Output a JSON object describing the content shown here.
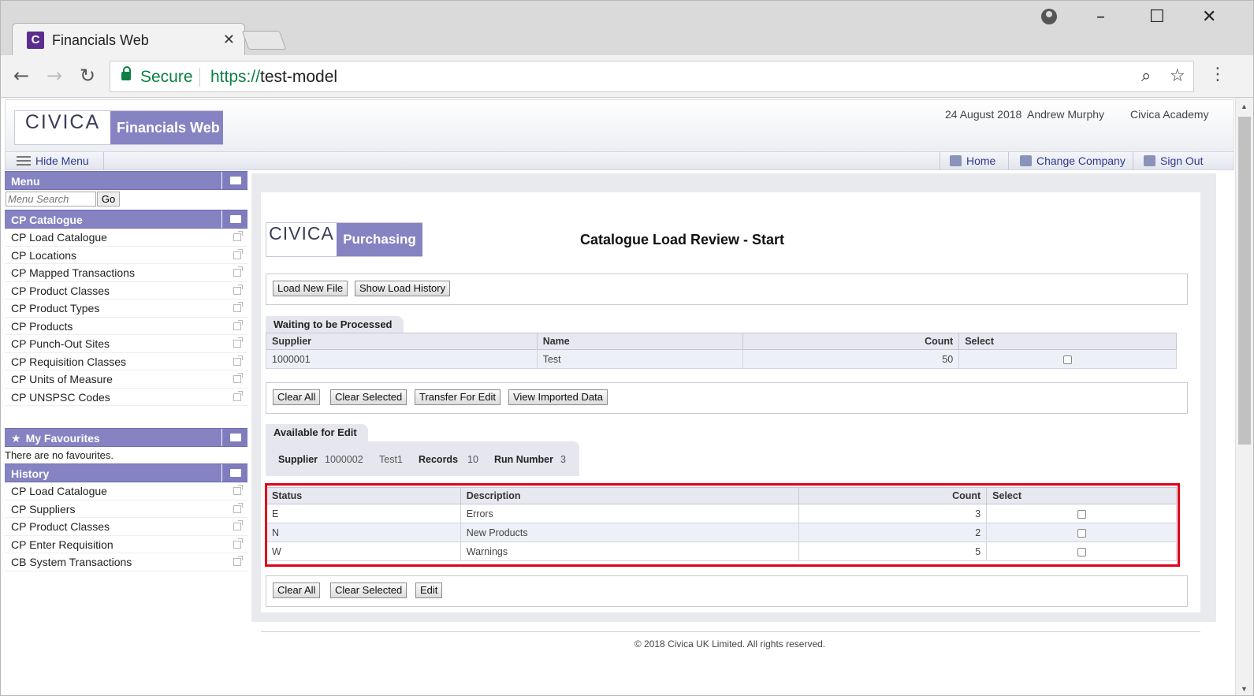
{
  "browser": {
    "tab_title": "Financials Web",
    "tab_favicon": "C",
    "tab_close": "✕",
    "secure_label": "Secure",
    "url_protocol": "https://",
    "url_host": "test-model"
  },
  "app": {
    "logo_text": "CIVICA",
    "app_name": "Financials Web",
    "date": "24 August 2018",
    "user": "Andrew Murphy",
    "company": "Civica Academy",
    "hide_menu": "Hide Menu",
    "nav": {
      "home": "Home",
      "change_company": "Change Company",
      "sign_out": "Sign Out"
    }
  },
  "sidebar": {
    "menu_title": "Menu",
    "search_placeholder": "Menu Search",
    "go_label": "Go",
    "catalogue_title": "CP Catalogue",
    "catalogue_items": [
      "CP Load Catalogue",
      "CP Locations",
      "CP Mapped Transactions",
      "CP Product Classes",
      "CP Product Types",
      "CP Products",
      "CP Punch-Out Sites",
      "CP Requisition Classes",
      "CP Units of Measure",
      "CP UNSPSC Codes"
    ],
    "favourites_title": "My Favourites",
    "no_favourites": "There are no favourites.",
    "history_title": "History",
    "history_items": [
      "CP Load Catalogue",
      "CP Suppliers",
      "CP Product Classes",
      "CP Enter Requisition",
      "CB System Transactions"
    ]
  },
  "main": {
    "module_logo_text": "CIVICA",
    "module_name": "Purchasing",
    "page_title": "Catalogue Load Review - Start",
    "top_buttons": {
      "load_new_file": "Load New File",
      "show_load_history": "Show Load History"
    },
    "waiting": {
      "title": "Waiting to be Processed",
      "headers": {
        "supplier": "Supplier",
        "name": "Name",
        "count": "Count",
        "select": "Select"
      },
      "rows": [
        {
          "supplier": "1000001",
          "name": "Test",
          "count": "50"
        }
      ]
    },
    "waiting_buttons": {
      "clear_all": "Clear All",
      "clear_selected": "Clear Selected",
      "transfer_for_edit": "Transfer For Edit",
      "view_imported_data": "View Imported Data"
    },
    "available": {
      "title": "Available for Edit",
      "supplier_label": "Supplier",
      "supplier_code": "1000002",
      "supplier_name": "Test1",
      "records_label": "Records",
      "records_value": "10",
      "run_label": "Run Number",
      "run_value": "3",
      "headers": {
        "status": "Status",
        "description": "Description",
        "count": "Count",
        "select": "Select"
      },
      "rows": [
        {
          "status": "E",
          "description": "Errors",
          "count": "3"
        },
        {
          "status": "N",
          "description": "New Products",
          "count": "2"
        },
        {
          "status": "W",
          "description": "Warnings",
          "count": "5"
        }
      ]
    },
    "available_buttons": {
      "clear_all": "Clear All",
      "clear_selected": "Clear Selected",
      "edit": "Edit"
    },
    "footer": "© 2018 Civica UK Limited. All rights reserved."
  },
  "colors": {
    "accent": "#8583c2",
    "link": "#2e3a8c",
    "highlight": "#e0001b",
    "secure": "#0b8043"
  }
}
